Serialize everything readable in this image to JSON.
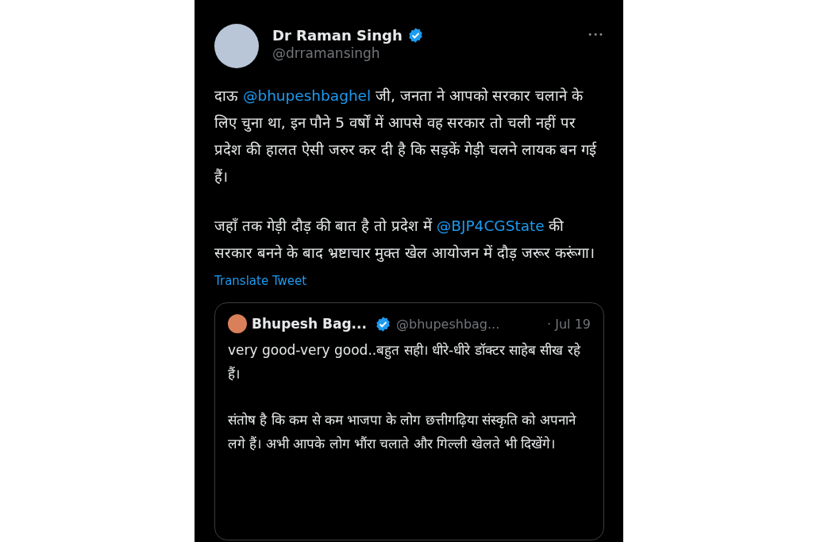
{
  "tweet": {
    "author": {
      "name": "Dr Raman Singh",
      "handle": "@drramansingh",
      "verified": true
    },
    "more": "•••",
    "paragraphs": [
      [
        {
          "kind": "text",
          "text": "दाऊ "
        },
        {
          "kind": "mention",
          "text": "@bhupeshbaghel"
        },
        {
          "kind": "text",
          "text": " जी, जनता ने आपको सरकार चलाने के लिए चुना था, इन पौने 5 वर्षों में आपसे वह सरकार तो चली नहीं पर प्रदेश की हालत ऐसी जरुर कर दी है कि सड़कें गेड़ी चलने लायक बन गई हैं।"
        }
      ],
      [
        {
          "kind": "text",
          "text": "जहाँ तक गेड़ी दौड़ की बात है तो प्रदेश में "
        },
        {
          "kind": "mention",
          "text": "@BJP4CGState"
        },
        {
          "kind": "text",
          "text": " की सरकार बनने के बाद भ्रष्टाचार मुक्त खेल आयोजन में दौड़ जरूर करूंगा।"
        }
      ]
    ],
    "translate": "Translate Tweet",
    "quote": {
      "author": {
        "name": "Bhupesh Bag...",
        "handle": "@bhupeshbag...",
        "verified": true
      },
      "date": "· Jul 19",
      "paragraphs": [
        "very good-very good..बहुत सही। धीरे-धीरे डॉक्टर साहेब सीख रहे हैं।",
        "संतोष है कि कम से कम भाजपा के लोग छत्तीगढ़िया संस्कृति को अपनाने लगे हैं। अभी आपके लोग भौंरा चलाते और गिल्ली खेलते भी दिखेंगे।"
      ]
    }
  }
}
